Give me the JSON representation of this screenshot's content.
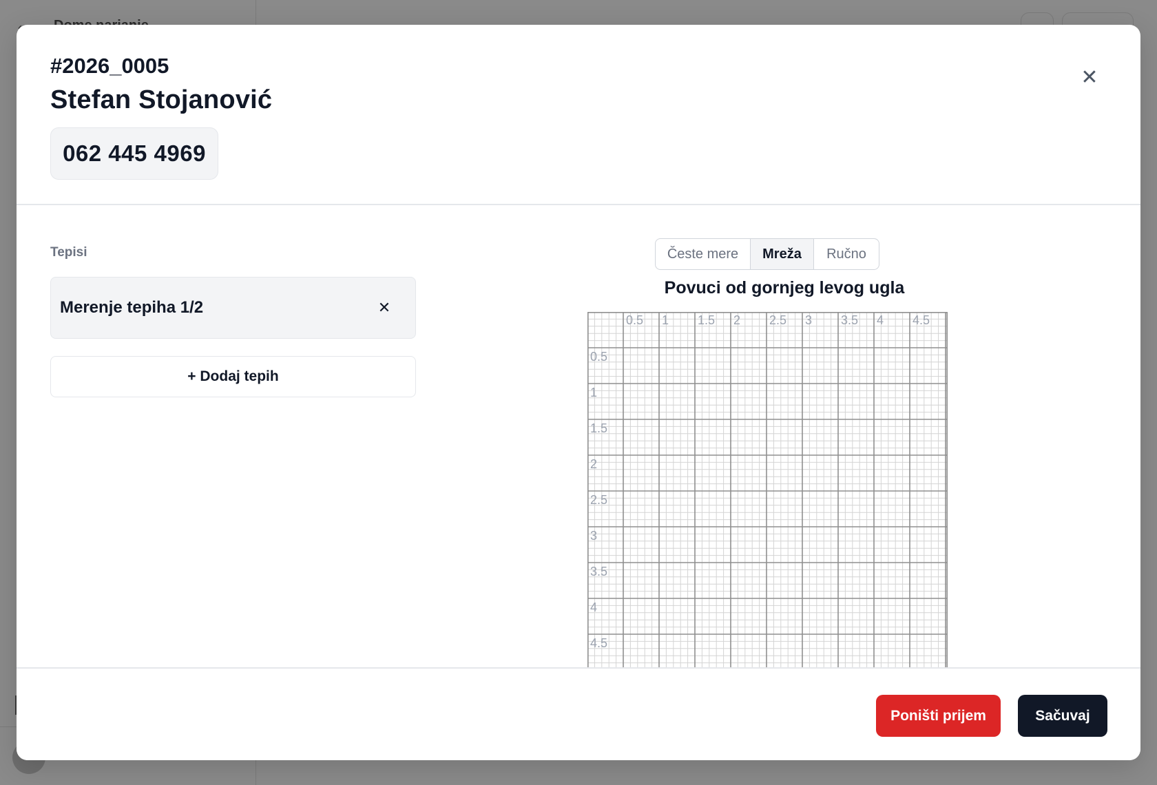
{
  "background": {
    "app_title": "Dome narianie"
  },
  "modal": {
    "order_id": "#2026_0005",
    "customer_name": "Stefan Stojanović",
    "phone": "062 445 4969",
    "close_icon": "close-icon"
  },
  "carpets": {
    "section_label": "Tepisi",
    "items": [
      {
        "label": "Merenje tepiha 1/2",
        "remove_icon": "close-icon"
      }
    ],
    "add_label": "+ Dodaj tepih"
  },
  "measure": {
    "modes": [
      {
        "label": "Česte mere",
        "active": false
      },
      {
        "label": "Mreža",
        "active": true
      },
      {
        "label": "Ručno",
        "active": false
      }
    ],
    "instruction": "Povuci od gornjeg levog ugla",
    "grid": {
      "top_labels": [
        "0.5",
        "1",
        "1.5",
        "2",
        "2.5",
        "3",
        "3.5",
        "4",
        "4.5"
      ],
      "left_labels": [
        "0.5",
        "1",
        "1.5",
        "2",
        "2.5",
        "3",
        "3.5",
        "4",
        "4.5"
      ],
      "major_step": 0.5,
      "minor_divisions": 5,
      "max_x": 5,
      "max_y": 5
    }
  },
  "footer": {
    "cancel_label": "Poništi prijem",
    "save_label": "Sačuvaj"
  },
  "colors": {
    "danger": "#dc2626",
    "primary": "#111827",
    "overlay": "#8a8a8a"
  }
}
